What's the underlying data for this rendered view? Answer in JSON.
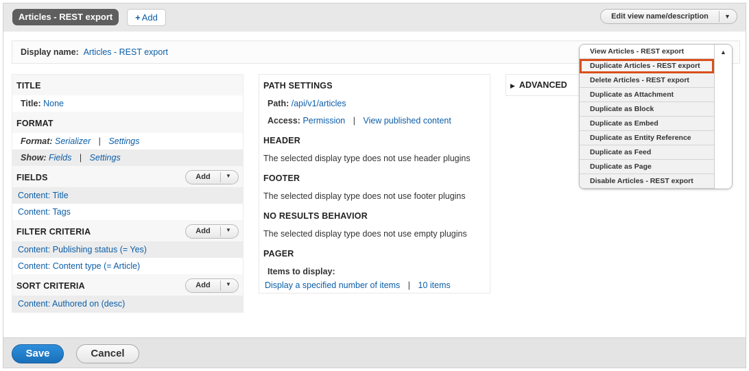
{
  "header": {
    "active_tab": "Articles - REST export",
    "add_display": {
      "icon": "plus-icon",
      "label": "Add"
    },
    "edit_view": {
      "label": "Edit view name/description"
    }
  },
  "display_name": {
    "label": "Display name:",
    "value": "Articles - REST export"
  },
  "col1": {
    "title": {
      "heading": "TITLE",
      "label": "Title:",
      "value": "None"
    },
    "format": {
      "heading": "FORMAT",
      "format_label": "Format:",
      "format_value": "Serializer",
      "format_settings": "Settings",
      "show_label": "Show:",
      "show_value": "Fields",
      "show_settings": "Settings",
      "separator": "|"
    },
    "fields": {
      "heading": "FIELDS",
      "add": "Add",
      "items": [
        "Content: Title",
        "Content: Tags"
      ]
    },
    "filter": {
      "heading": "FILTER CRITERIA",
      "add": "Add",
      "items": [
        "Content: Publishing status (= Yes)",
        "Content: Content type (= Article)"
      ]
    },
    "sort": {
      "heading": "SORT CRITERIA",
      "add": "Add",
      "items": [
        "Content: Authored on (desc)"
      ]
    }
  },
  "col2": {
    "path_settings": {
      "heading": "PATH SETTINGS",
      "path_label": "Path:",
      "path_value": "/api/v1/articles",
      "access_label": "Access:",
      "access_value": "Permission",
      "access_extra": "View published content",
      "separator": "|"
    },
    "header": {
      "heading": "HEADER",
      "text": "The selected display type does not use header plugins"
    },
    "footer": {
      "heading": "FOOTER",
      "text": "The selected display type does not use footer plugins"
    },
    "no_results": {
      "heading": "NO RESULTS BEHAVIOR",
      "text": "The selected display type does not use empty plugins"
    },
    "pager": {
      "heading": "PAGER",
      "items_label": "Items to display:",
      "mode": "Display a specified number of items",
      "count": "10 items",
      "separator": "|"
    }
  },
  "col3": {
    "advanced": "ADVANCED"
  },
  "dropdown": {
    "items": [
      "View Articles - REST export",
      "Duplicate Articles - REST export",
      "Delete Articles - REST export",
      "Duplicate as Attachment",
      "Duplicate as Block",
      "Duplicate as Embed",
      "Duplicate as Entity Reference",
      "Duplicate as Feed",
      "Duplicate as Page",
      "Disable Articles - REST export"
    ],
    "highlighted_index": 1,
    "highlight_color": "#d9501c"
  },
  "footer_bar": {
    "save": "Save",
    "cancel": "Cancel"
  },
  "colors": {
    "link": "#0b5ea8",
    "primary": "#1a6fb8"
  }
}
